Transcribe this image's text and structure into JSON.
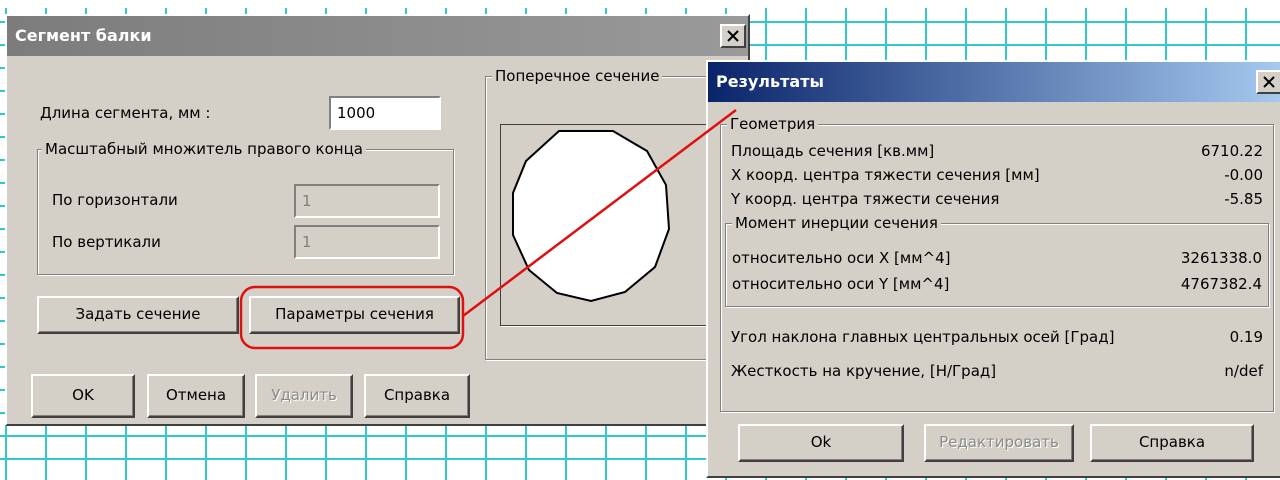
{
  "segment_dialog": {
    "title": "Сегмент балки",
    "length_label": "Длина сегмента, мм :",
    "length_value": "1000",
    "scale_group_title": "Масштабный множитель правого конца",
    "horizontal_label": "По горизонтали",
    "horizontal_value": "1",
    "vertical_label": "По вертикали",
    "vertical_value": "1",
    "cross_section_title": "Поперечное сечение",
    "set_section_button": "Задать сечение",
    "section_params_button": "Параметры сечения",
    "ok_button": "OK",
    "cancel_button": "Отмена",
    "delete_button": "Удалить",
    "help_button": "Справка"
  },
  "results_dialog": {
    "title": "Результаты",
    "geometry_group": "Геометрия",
    "area_label": "Площадь сечения   [кв.мм]",
    "area_value": "6710.22",
    "x_center_label": "X коорд. центра тяжести сечения [мм]",
    "x_center_value": "-0.00",
    "y_center_label": "Y коорд. центра тяжести сечения",
    "y_center_value": "-5.85",
    "inertia_group": "Момент инерции сечения",
    "ix_label": "относительно оси X   [мм^4]",
    "ix_value": "3261338.0",
    "iy_label": "относительно оси Y   [мм^4]",
    "iy_value": "4767382.4",
    "angle_label": "Угол наклона главных центральных осей [Град]",
    "angle_value": "0.19",
    "torsion_label": "Жесткость на кручение, [Н/Град]",
    "torsion_value": "n/def",
    "ok_button": "Ok",
    "edit_button": "Редактировать",
    "help_button": "Справка"
  },
  "icons": {
    "close": "close-icon",
    "section_shape": "circle-section-icon"
  },
  "colors": {
    "highlight": "#e01010",
    "grid": "#2fc9c9",
    "title_active": "#0a246a",
    "title_inactive": "#808080",
    "dialog_face": "#d4d0c8"
  }
}
